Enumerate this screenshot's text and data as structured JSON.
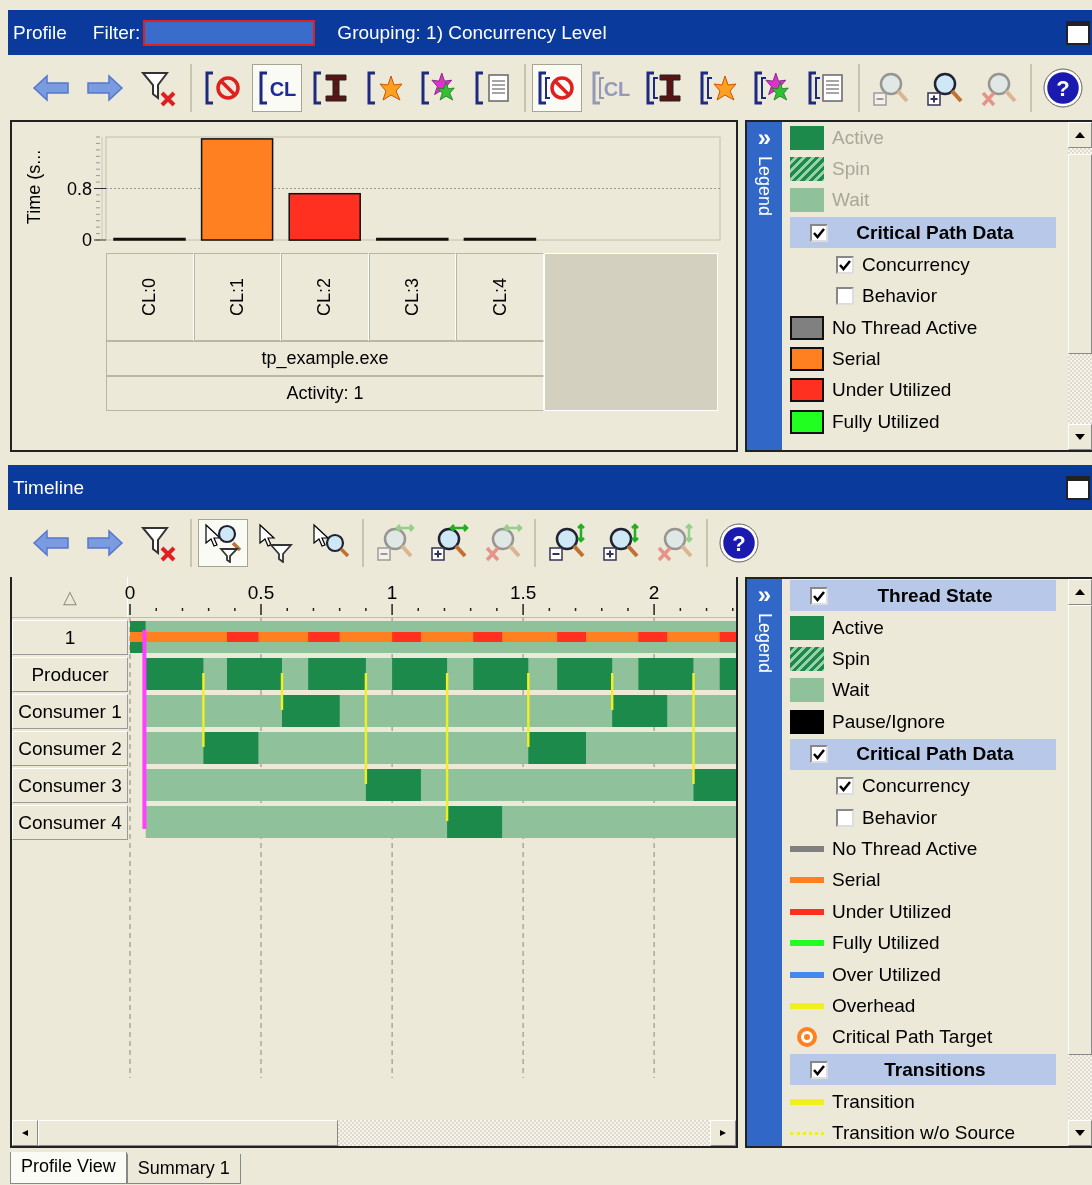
{
  "profile": {
    "title": "Profile",
    "filter_label": "Filter:",
    "grouping": "Grouping: 1) Concurrency Level",
    "toolbar": [
      [
        {
          "kind": "back",
          "pressed": false,
          "disabled": false
        },
        {
          "kind": "forward",
          "pressed": false,
          "disabled": false
        },
        {
          "kind": "filter-clear",
          "pressed": false,
          "disabled": false
        }
      ],
      [
        {
          "kind": "bracket-no",
          "pressed": false,
          "disabled": false
        },
        {
          "kind": "bracket-cl",
          "label": "CL",
          "pressed": true,
          "disabled": false
        },
        {
          "kind": "bracket-thread",
          "pressed": false,
          "disabled": false
        },
        {
          "kind": "bracket-splash",
          "pressed": false,
          "disabled": false
        },
        {
          "kind": "bracket-multi",
          "pressed": false,
          "disabled": false
        },
        {
          "kind": "bracket-document",
          "pressed": false,
          "disabled": false
        }
      ],
      [
        {
          "kind": "double-bracket-no",
          "pressed": true,
          "disabled": false
        },
        {
          "kind": "double-bracket-cl",
          "label": "CL",
          "pressed": false,
          "disabled": true
        },
        {
          "kind": "double-bracket-thread",
          "pressed": false,
          "disabled": false
        },
        {
          "kind": "double-bracket-splash",
          "pressed": false,
          "disabled": false
        },
        {
          "kind": "double-bracket-multi",
          "pressed": false,
          "disabled": false
        },
        {
          "kind": "double-bracket-document",
          "pressed": false,
          "disabled": false
        }
      ],
      [
        {
          "kind": "zoom-out",
          "pressed": false,
          "disabled": true
        },
        {
          "kind": "zoom-in",
          "pressed": false,
          "disabled": false
        },
        {
          "kind": "zoom-reset",
          "pressed": false,
          "disabled": true
        }
      ],
      [
        {
          "kind": "help",
          "label": "?",
          "pressed": false,
          "disabled": false
        }
      ]
    ],
    "chart": {
      "chart_data": {
        "type": "bar",
        "ylabel": "Time (s...",
        "categories": [
          "CL:0",
          "CL:1",
          "CL:2",
          "CL:3",
          "CL:4"
        ],
        "stacked": true,
        "ylim": [
          0,
          1.6
        ],
        "yticks": [
          0,
          0.8
        ],
        "series": [
          {
            "color": "#808080",
            "values": [
              0,
              null,
              null,
              null,
              null
            ]
          },
          {
            "color": "#ff8020",
            "values": [
              null,
              1.57,
              null,
              null,
              null
            ]
          },
          {
            "color": "#ff3020",
            "values": [
              null,
              null,
              0.72,
              null,
              null
            ]
          },
          {
            "color": "#20ff20",
            "values": [
              null,
              null,
              null,
              0,
              null
            ]
          },
          {
            "color": "#4488ee",
            "values": [
              null,
              null,
              null,
              null,
              0
            ]
          }
        ]
      },
      "process": "tp_example.exe",
      "activity": "Activity: 1"
    },
    "legend": {
      "toggle": "»",
      "title": "Legend",
      "items": [
        {
          "kind": "fill",
          "label": "Active",
          "color": "#1b8a4a",
          "disabled": true
        },
        {
          "kind": "hatch",
          "label": "Spin",
          "color": "#1b8a4a",
          "disabled": true
        },
        {
          "kind": "fill",
          "label": "Wait",
          "color": "#8fc29a",
          "disabled": true
        },
        {
          "kind": "header",
          "label": "Critical Path Data",
          "checked": true,
          "disabled": false
        },
        {
          "kind": "check",
          "label": "Concurrency",
          "checked": true,
          "disabled": false
        },
        {
          "kind": "check",
          "label": "Behavior",
          "checked": false,
          "disabled": false
        },
        {
          "kind": "box",
          "label": "No Thread Active",
          "color": "#808080",
          "disabled": false
        },
        {
          "kind": "box",
          "label": "Serial",
          "color": "#ff8020",
          "disabled": false
        },
        {
          "kind": "box",
          "label": "Under Utilized",
          "color": "#ff3020",
          "disabled": false
        },
        {
          "kind": "box",
          "label": "Fully Utilized",
          "color": "#20ff20",
          "disabled": false
        }
      ]
    }
  },
  "timeline": {
    "title": "Timeline",
    "toolbar": [
      [
        {
          "kind": "back",
          "pressed": false,
          "disabled": false
        },
        {
          "kind": "forward",
          "pressed": false,
          "disabled": false
        },
        {
          "kind": "filter-clear",
          "pressed": false,
          "disabled": false
        }
      ],
      [
        {
          "kind": "pointer-zoom-filter",
          "pressed": true,
          "disabled": false
        },
        {
          "kind": "pointer-filter",
          "pressed": false,
          "disabled": false
        },
        {
          "kind": "pointer-zoom",
          "pressed": false,
          "disabled": false
        }
      ],
      [
        {
          "kind": "h-zoom-out",
          "pressed": false,
          "disabled": true
        },
        {
          "kind": "h-zoom-in",
          "pressed": false,
          "disabled": false
        },
        {
          "kind": "h-zoom-reset",
          "pressed": false,
          "disabled": true
        }
      ],
      [
        {
          "kind": "v-zoom-out",
          "pressed": false,
          "disabled": false
        },
        {
          "kind": "v-zoom-in",
          "pressed": false,
          "disabled": false
        },
        {
          "kind": "v-zoom-reset",
          "pressed": false,
          "disabled": true
        }
      ],
      [
        {
          "kind": "help",
          "label": "?",
          "pressed": false,
          "disabled": false
        }
      ]
    ],
    "sort_indicator": "△",
    "time_axis": [
      "0",
      "0.5",
      "1",
      "1.5",
      "2"
    ],
    "rows": [
      "1",
      "Producer",
      "Consumer 1",
      "Consumer 2",
      "Consumer 3",
      "Consumer 4"
    ],
    "legend": {
      "toggle": "»",
      "title": "Legend",
      "items": [
        {
          "kind": "header",
          "label": "Thread State",
          "checked": true
        },
        {
          "kind": "fill",
          "label": "Active",
          "color": "#1b8a4a"
        },
        {
          "kind": "hatch",
          "label": "Spin",
          "color": "#1b8a4a"
        },
        {
          "kind": "fill",
          "label": "Wait",
          "color": "#8fc29a"
        },
        {
          "kind": "fill",
          "label": "Pause/Ignore",
          "color": "#000000"
        },
        {
          "kind": "header",
          "label": "Critical Path Data",
          "checked": true
        },
        {
          "kind": "check",
          "label": "Concurrency",
          "checked": true
        },
        {
          "kind": "check",
          "label": "Behavior",
          "checked": false
        },
        {
          "kind": "line",
          "label": "No Thread Active",
          "color": "#808080"
        },
        {
          "kind": "line",
          "label": "Serial",
          "color": "#ff8020"
        },
        {
          "kind": "line",
          "label": "Under Utilized",
          "color": "#ff3020"
        },
        {
          "kind": "line",
          "label": "Fully Utilized",
          "color": "#20ff20"
        },
        {
          "kind": "line",
          "label": "Over Utilized",
          "color": "#4488ee"
        },
        {
          "kind": "line",
          "label": "Overhead",
          "color": "#f0f020"
        },
        {
          "kind": "target",
          "label": "Critical Path Target",
          "color": "#ff8020"
        },
        {
          "kind": "header",
          "label": "Transitions",
          "checked": true
        },
        {
          "kind": "line",
          "label": "Transition",
          "color": "#f0f020"
        },
        {
          "kind": "dotted",
          "label": "Transition w/o Source",
          "color": "#f0f020"
        }
      ]
    }
  },
  "tabs": [
    {
      "label": "Profile View",
      "selected": true
    },
    {
      "label": "Summary 1",
      "selected": false
    }
  ]
}
